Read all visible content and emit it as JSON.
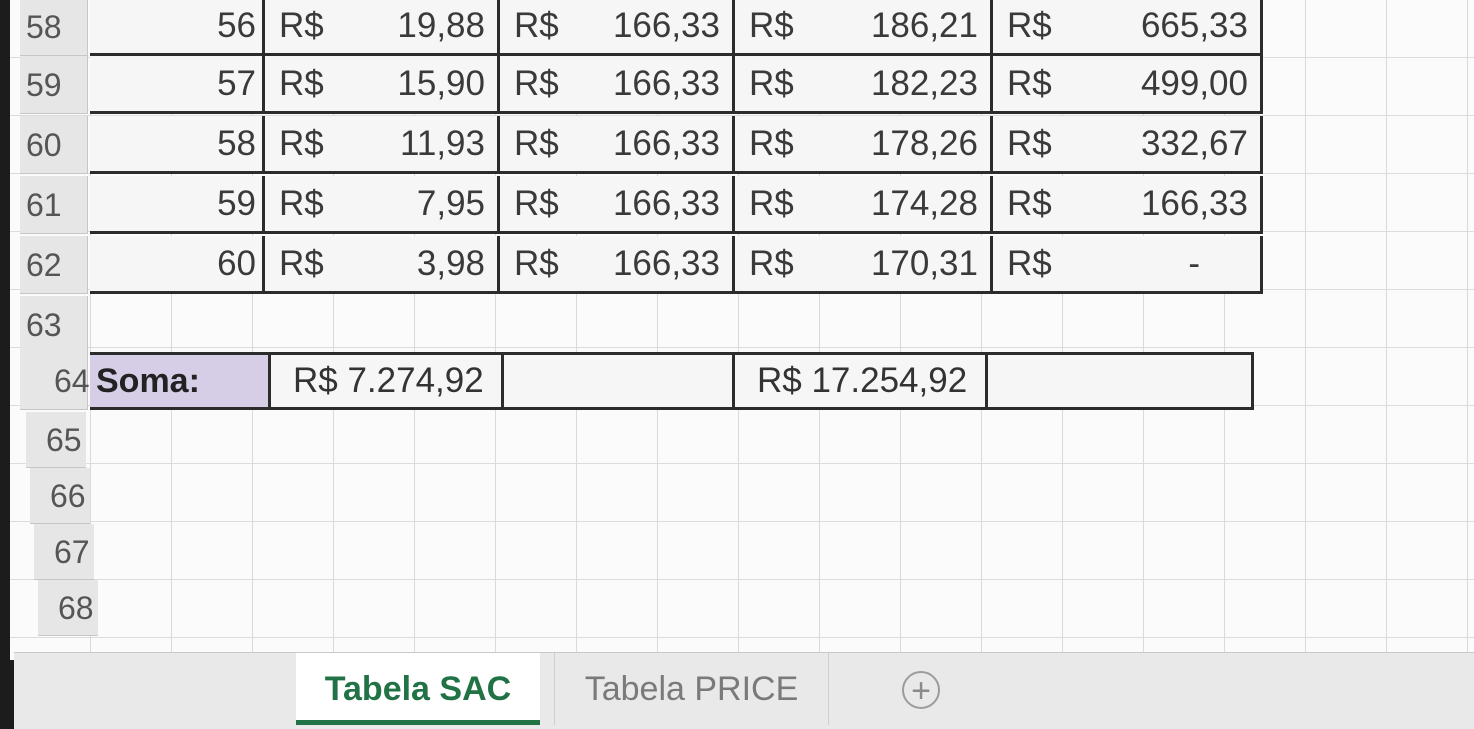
{
  "rows": [
    {
      "num": "58",
      "period": "56",
      "c1": "19,88",
      "c2": "166,33",
      "c3": "186,21",
      "c4": "665,33"
    },
    {
      "num": "59",
      "period": "57",
      "c1": "15,90",
      "c2": "166,33",
      "c3": "182,23",
      "c4": "499,00"
    },
    {
      "num": "60",
      "period": "58",
      "c1": "11,93",
      "c2": "166,33",
      "c3": "178,26",
      "c4": "332,67"
    },
    {
      "num": "61",
      "period": "59",
      "c1": "7,95",
      "c2": "166,33",
      "c3": "174,28",
      "c4": "166,33"
    },
    {
      "num": "62",
      "period": "60",
      "c1": "3,98",
      "c2": "166,33",
      "c3": "170,31",
      "c4": "-"
    }
  ],
  "currency": "R$",
  "row63": "63",
  "soma": {
    "num": "64",
    "label": "Soma:",
    "total_juros": "R$ 7.274,92",
    "total_prestacao": "R$ 17.254,92"
  },
  "empty_rows": [
    "65",
    "66",
    "67",
    "68"
  ],
  "tabs": {
    "active": "Tabela SAC",
    "inactive": "Tabela PRICE",
    "add": "+"
  },
  "colors": {
    "accent": "#217346",
    "soma_bg": "#d6cde6"
  }
}
